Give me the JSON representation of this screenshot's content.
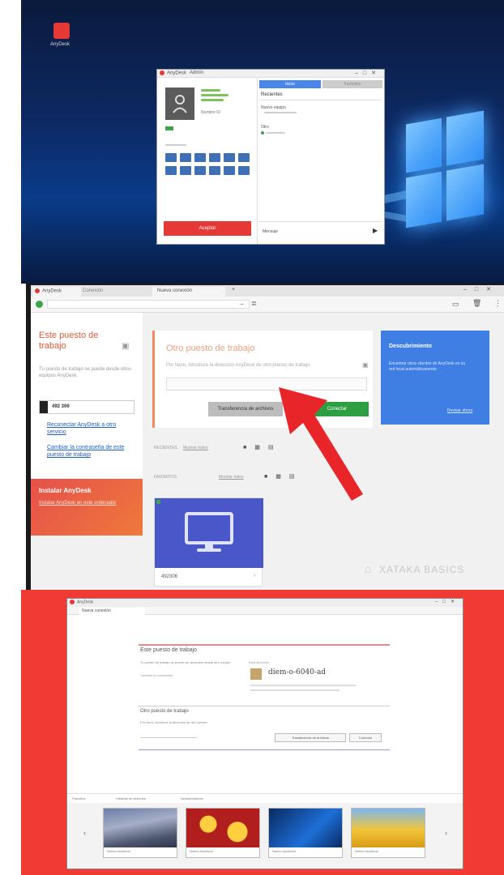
{
  "panel1": {
    "desktop_icon_label": "AnyDesk",
    "tabs": [
      "AnyDesk",
      "Admin"
    ],
    "status_name": "Nombre ID",
    "tab_right_1": "Inicio",
    "tab_right_2": "Favoritos",
    "recent_heading": "Recientes",
    "item1": "Nuevo equipo",
    "item2": "Otro",
    "accept_label": "Aceptar",
    "footer_left": "Mensaje"
  },
  "panel2": {
    "tabs": [
      "AnyDesk",
      "Conexión",
      "Nueva conexión"
    ],
    "sidebar_title": "Este puesto de trabajo",
    "sidebar_desc": "Tu puesto de trabajo se puede desde otros equipos AnyDesk.",
    "address": "492 306",
    "link1": "Reconectar AnyDesk a otro servicio",
    "link2": "Cambiar la contraseña de este puesto de trabajo",
    "promo_title": "Instalar AnyDesk",
    "promo_text": "Instalar AnyDesk en este ordenador",
    "other_title": "Otro puesto de trabajo",
    "other_desc": "Por favor, introduce la dirección AnyDesk de otro puesto de trabajo",
    "transfer_label": "Transferencia de archivos",
    "connect_label": "Conectar",
    "discover_title": "Descubrimiento",
    "discover_text": "Encontrar otros clientes de AnyDesk en su red local automáticamente.",
    "discover_link": "Revisar ahora",
    "recent_label": "RECIENTES",
    "recent_link": "Mostrar todos",
    "favorites_label": "FAVORITOS",
    "favorites_link": "Mostrar todos",
    "card_label": "492306",
    "watermark": "XATAKA BASICS"
  },
  "panel3": {
    "title": "AnyDesk",
    "tab": "Nueva conexión",
    "this_title": "Este puesto de trabajo",
    "this_desc": "Tu puesto de trabajo se puede ser accedido desde otro equipo",
    "this_link": "Cambiar la contraseña",
    "address_label": "Esta dirección",
    "address_value": "diem-o-6040-ad",
    "other_title": "Otro puesto de trabajo",
    "other_desc": "Por favor, introduce la dirección de otro puesto",
    "transfer_label": "Transferencia de archivos",
    "connect_label": "Conectar",
    "nav1": "Favoritos",
    "nav2": "Historial de sesiones",
    "nav3": "Descubrimiento",
    "thumb_label": "Nuevo escritorio"
  }
}
